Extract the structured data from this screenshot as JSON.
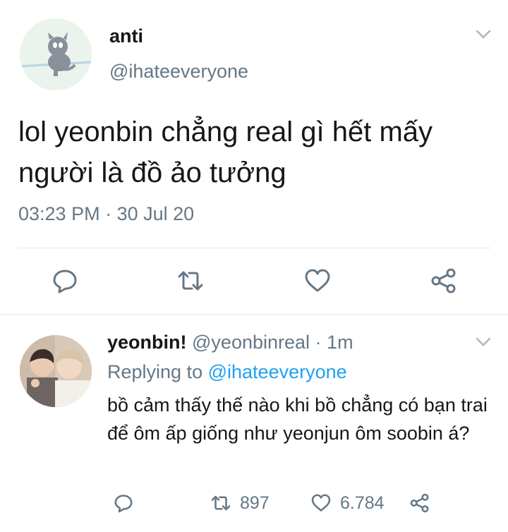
{
  "main_tweet": {
    "name": "anti",
    "handle": "@ihateeveryone",
    "text": "lol yeonbin chẳng real gì hết mấy người là đồ ảo tưởng",
    "time": "03:23 PM",
    "separator": "·",
    "date": "30 Jul 20"
  },
  "reply_tweet": {
    "name": "yeonbin!",
    "handle": "@yeonbinreal",
    "separator": "·",
    "age": "1m",
    "replying_prefix": "Replying to",
    "replying_to": "@ihateeveryone",
    "text": "bồ cảm thấy thế nào khi bồ chẳng có bạn trai để ôm ấp giống như yeonjun ôm soobin á?",
    "retweet_count": "897",
    "like_count": "6.784"
  },
  "colors": {
    "text": "#14171a",
    "secondary": "#657786",
    "link": "#1da1f2",
    "divider": "#e1e8ed"
  },
  "icons": [
    "chevron-down-icon",
    "reply-icon",
    "retweet-icon",
    "like-icon",
    "share-icon"
  ]
}
